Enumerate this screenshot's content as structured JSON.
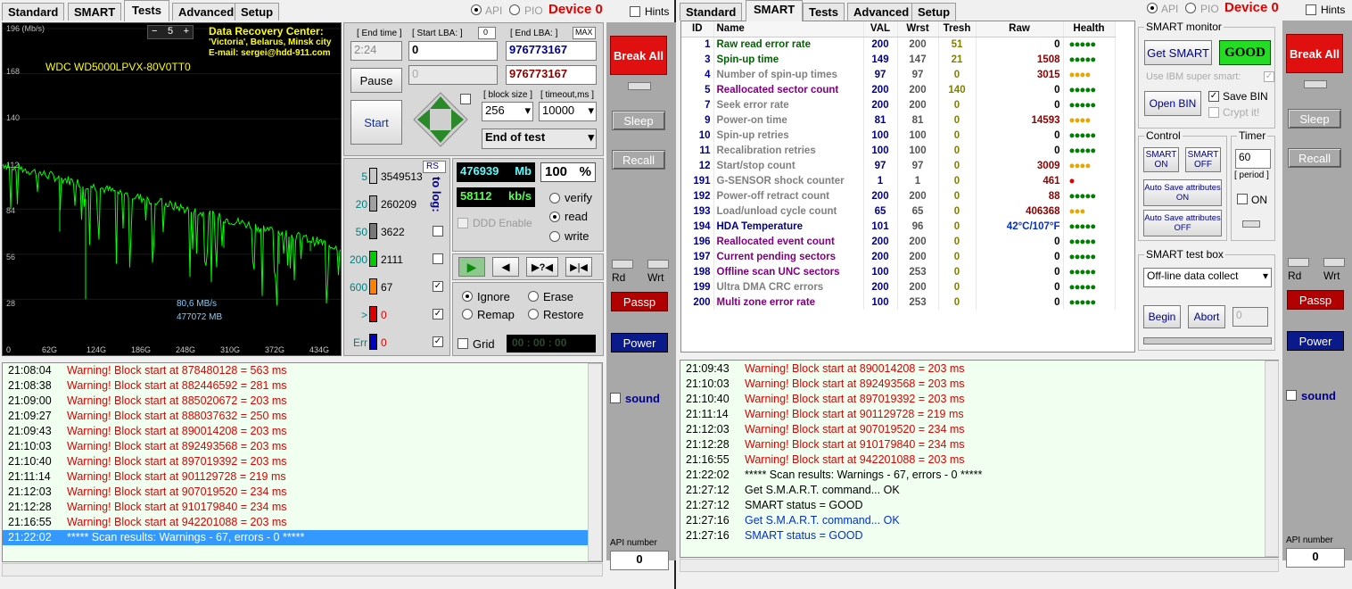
{
  "tabs": [
    "Standard",
    "SMART",
    "Tests",
    "Advanced",
    "Setup"
  ],
  "header": {
    "api": "API",
    "pio": "PIO",
    "device": "Device 0",
    "hints": "Hints"
  },
  "graph": {
    "y_labels": [
      "196 (Mb/s)",
      "168",
      "140",
      "112",
      "84",
      "56",
      "28"
    ],
    "x_labels": [
      "0",
      "62G",
      "124G",
      "186G",
      "248G",
      "310G",
      "372G",
      "434G"
    ],
    "drive": "WDC WD5000LPVX-80V0TT0",
    "zoom": "5",
    "center_title": "Data Recovery Center:",
    "center_loc": "'Victoria', Belarus, Minsk city",
    "center_mail": "E-mail: sergei@hdd-911.com",
    "speed": "80,6 MB/s",
    "mb": "477072 MB",
    "line_color": "#00ff00"
  },
  "controls": {
    "end_time_label": "[ End time ]",
    "end_time": "2:24",
    "start_lba_label": "[ Start LBA: ]",
    "start_lba": "0",
    "start_lba_box": "0",
    "end_lba_label": "[ End LBA: ]",
    "max": "MAX",
    "end_lba": "976773167",
    "cur_lba_a": "0",
    "cur_lba_b": "976773167",
    "pause": "Pause",
    "start": "Start",
    "block_size_label": "[ block size ]",
    "block_size": "256",
    "timeout_label": "[ timeout,ms ]",
    "timeout": "10000",
    "end_mode": "End of test"
  },
  "blocks": {
    "rs": "RS",
    "to_log": "to log:",
    "rows": [
      {
        "label": "5",
        "count": "3549513",
        "color": "#c8c8c8"
      },
      {
        "label": "20",
        "count": "260209",
        "color": "#a0a0a0"
      },
      {
        "label": "50",
        "count": "3622",
        "color": "#787878"
      },
      {
        "label": "200",
        "count": "2111",
        "color": "#00cc00"
      },
      {
        "label": "600",
        "count": "67",
        "color": "#ff8000"
      },
      {
        "label": ">",
        "count": "0",
        "color": "#e00000"
      },
      {
        "label": "Err",
        "count": "0",
        "color": "#0000c0"
      }
    ]
  },
  "progress": {
    "mb": "476939",
    "mb_unit": "Mb",
    "pct": "100",
    "pct_unit": "%",
    "speed": "58112",
    "speed_unit": "kb/s",
    "ddd": "DDD Enable"
  },
  "modes": {
    "verify": "verify",
    "read": "read",
    "write": "write"
  },
  "actions": {
    "ignore": "Ignore",
    "erase": "Erase",
    "remap": "Remap",
    "restore": "Restore",
    "grid": "Grid",
    "timer": "00 : 00 : 00"
  },
  "side": {
    "break_all": "Break All",
    "sleep": "Sleep",
    "recall": "Recall",
    "rd": "Rd",
    "wrt": "Wrt",
    "passp": "Passp",
    "power": "Power",
    "sound": "sound",
    "api_number": "API number",
    "api_value": "0"
  },
  "left_log": [
    {
      "t": "21:08:04",
      "m": "Warning! Block start at 878480128 = 563 ms",
      "c": "red"
    },
    {
      "t": "21:08:38",
      "m": "Warning! Block start at 882446592 = 281 ms",
      "c": "red"
    },
    {
      "t": "21:09:00",
      "m": "Warning! Block start at 885020672 = 203 ms",
      "c": "red"
    },
    {
      "t": "21:09:27",
      "m": "Warning! Block start at 888037632 = 250 ms",
      "c": "red"
    },
    {
      "t": "21:09:43",
      "m": "Warning! Block start at 890014208 = 203 ms",
      "c": "red"
    },
    {
      "t": "21:10:03",
      "m": "Warning! Block start at 892493568 = 203 ms",
      "c": "red"
    },
    {
      "t": "21:10:40",
      "m": "Warning! Block start at 897019392 = 203 ms",
      "c": "red"
    },
    {
      "t": "21:11:14",
      "m": "Warning! Block start at 901129728 = 219 ms",
      "c": "red"
    },
    {
      "t": "21:12:03",
      "m": "Warning! Block start at 907019520 = 234 ms",
      "c": "red"
    },
    {
      "t": "21:12:28",
      "m": "Warning! Block start at 910179840 = 234 ms",
      "c": "red"
    },
    {
      "t": "21:16:55",
      "m": "Warning! Block start at 942201088 = 203 ms",
      "c": "red"
    },
    {
      "t": "21:22:02",
      "m": "***** Scan results: Warnings - 67, errors - 0 *****",
      "c": "sel"
    }
  ],
  "right_log": [
    {
      "t": "21:09:43",
      "m": "Warning! Block start at 890014208 = 203 ms",
      "c": "red"
    },
    {
      "t": "21:10:03",
      "m": "Warning! Block start at 892493568 = 203 ms",
      "c": "red"
    },
    {
      "t": "21:10:40",
      "m": "Warning! Block start at 897019392 = 203 ms",
      "c": "red"
    },
    {
      "t": "21:11:14",
      "m": "Warning! Block start at 901129728 = 219 ms",
      "c": "red"
    },
    {
      "t": "21:12:03",
      "m": "Warning! Block start at 907019520 = 234 ms",
      "c": "red"
    },
    {
      "t": "21:12:28",
      "m": "Warning! Block start at 910179840 = 234 ms",
      "c": "red"
    },
    {
      "t": "21:16:55",
      "m": "Warning! Block start at 942201088 = 203 ms",
      "c": "red"
    },
    {
      "t": "21:22:02",
      "m": "***** Scan results: Warnings - 67, errors - 0 *****",
      "c": "black"
    },
    {
      "t": "21:27:12",
      "m": "Get S.M.A.R.T. command... OK",
      "c": "black"
    },
    {
      "t": "21:27:12",
      "m": "SMART status = GOOD",
      "c": "black"
    },
    {
      "t": "21:27:16",
      "m": "Get S.M.A.R.T. command... OK",
      "c": "blue"
    },
    {
      "t": "21:27:16",
      "m": "SMART status = GOOD",
      "c": "blue"
    }
  ],
  "smart_table": {
    "headers": [
      "ID",
      "Name",
      "VAL",
      "Wrst",
      "Tresh",
      "Raw",
      "Health"
    ],
    "rows": [
      {
        "id": "1",
        "name": "Raw read error rate",
        "val": "200",
        "wrst": "200",
        "tresh": "51",
        "raw": "0",
        "health": "●●●●●",
        "nc": "#006400",
        "hc": "g"
      },
      {
        "id": "3",
        "name": "Spin-up time",
        "val": "149",
        "wrst": "147",
        "tresh": "21",
        "raw": "1508",
        "health": "●●●●●",
        "nc": "#006400",
        "hc": "g"
      },
      {
        "id": "4",
        "name": "Number of spin-up times",
        "val": "97",
        "wrst": "97",
        "tresh": "0",
        "raw": "3015",
        "health": "●●●●",
        "nc": "#808080",
        "hc": "y"
      },
      {
        "id": "5",
        "name": "Reallocated sector count",
        "val": "200",
        "wrst": "200",
        "tresh": "140",
        "raw": "0",
        "health": "●●●●●",
        "nc": "#800080",
        "hc": "g"
      },
      {
        "id": "7",
        "name": "Seek error rate",
        "val": "200",
        "wrst": "200",
        "tresh": "0",
        "raw": "0",
        "health": "●●●●●",
        "nc": "#808080",
        "hc": "g"
      },
      {
        "id": "9",
        "name": "Power-on time",
        "val": "81",
        "wrst": "81",
        "tresh": "0",
        "raw": "14593",
        "health": "●●●●",
        "nc": "#808080",
        "hc": "y"
      },
      {
        "id": "10",
        "name": "Spin-up retries",
        "val": "100",
        "wrst": "100",
        "tresh": "0",
        "raw": "0",
        "health": "●●●●●",
        "nc": "#808080",
        "hc": "g"
      },
      {
        "id": "11",
        "name": "Recalibration retries",
        "val": "100",
        "wrst": "100",
        "tresh": "0",
        "raw": "0",
        "health": "●●●●●",
        "nc": "#808080",
        "hc": "g"
      },
      {
        "id": "12",
        "name": "Start/stop count",
        "val": "97",
        "wrst": "97",
        "tresh": "0",
        "raw": "3009",
        "health": "●●●●",
        "nc": "#808080",
        "hc": "y"
      },
      {
        "id": "191",
        "name": "G-SENSOR shock counter",
        "val": "1",
        "wrst": "1",
        "tresh": "0",
        "raw": "461",
        "health": "●",
        "nc": "#808080",
        "hc": "r"
      },
      {
        "id": "192",
        "name": "Power-off retract count",
        "val": "200",
        "wrst": "200",
        "tresh": "0",
        "raw": "88",
        "health": "●●●●●",
        "nc": "#808080",
        "hc": "g"
      },
      {
        "id": "193",
        "name": "Load/unload cycle count",
        "val": "65",
        "wrst": "65",
        "tresh": "0",
        "raw": "406368",
        "health": "●●●",
        "nc": "#808080",
        "hc": "y"
      },
      {
        "id": "194",
        "name": "HDA Temperature",
        "val": "101",
        "wrst": "96",
        "tresh": "0",
        "raw": "42°C/107°F",
        "health": "●●●●●",
        "nc": "#000080",
        "hc": "g"
      },
      {
        "id": "196",
        "name": "Reallocated event count",
        "val": "200",
        "wrst": "200",
        "tresh": "0",
        "raw": "0",
        "health": "●●●●●",
        "nc": "#800080",
        "hc": "g"
      },
      {
        "id": "197",
        "name": "Current pending sectors",
        "val": "200",
        "wrst": "200",
        "tresh": "0",
        "raw": "0",
        "health": "●●●●●",
        "nc": "#800080",
        "hc": "g"
      },
      {
        "id": "198",
        "name": "Offline scan UNC sectors",
        "val": "100",
        "wrst": "253",
        "tresh": "0",
        "raw": "0",
        "health": "●●●●●",
        "nc": "#800080",
        "hc": "g"
      },
      {
        "id": "199",
        "name": "Ultra DMA CRC errors",
        "val": "200",
        "wrst": "200",
        "tresh": "0",
        "raw": "0",
        "health": "●●●●●",
        "nc": "#808080",
        "hc": "g"
      },
      {
        "id": "200",
        "name": "Multi zone error rate",
        "val": "100",
        "wrst": "253",
        "tresh": "0",
        "raw": "0",
        "health": "●●●●●",
        "nc": "#800080",
        "hc": "g"
      }
    ]
  },
  "smart_panel": {
    "monitor": "SMART monitor",
    "get_smart": "Get SMART",
    "status": "GOOD",
    "ibm": "Use IBM super smart:",
    "save_bin": "Save BIN",
    "crypt": "Crypt it!",
    "open_bin": "Open BIN",
    "control": "Control",
    "smart_on": "SMART ON",
    "smart_off": "SMART OFF",
    "auto_on": "Auto Save attributes ON",
    "auto_off": "Auto Save attributes OFF",
    "timer": "Timer",
    "timer_val": "60",
    "period": "[ period ]",
    "on": "ON",
    "test_box": "SMART test box",
    "test_select": "Off-line data collect",
    "begin": "Begin",
    "abort": "Abort",
    "test_val": "0"
  }
}
